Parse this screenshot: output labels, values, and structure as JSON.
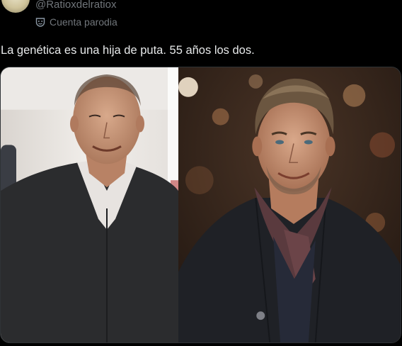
{
  "author": {
    "handle": "@Ratioxdelratiox",
    "badge_label": "Cuenta parodia",
    "badge_icon": "parody-mask-icon"
  },
  "tweet": {
    "text": "La genética es una hija de puta. 55 años los dos."
  },
  "media": {
    "layout": "two-photo-grid"
  },
  "colors": {
    "background": "#000000",
    "text_primary": "#e7e9ea",
    "text_secondary": "#71767b",
    "border": "#2f3336"
  }
}
